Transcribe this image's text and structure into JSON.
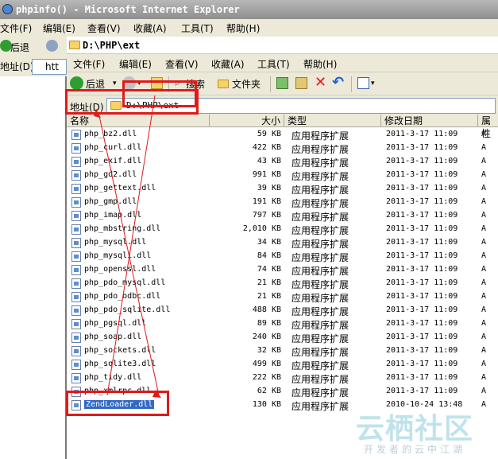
{
  "ie_window": {
    "title": "phpinfo() - Microsoft Internet Explorer",
    "menu": [
      "文件(F)",
      "编辑(E)",
      "查看(V)",
      "收藏(A)",
      "工具(T)",
      "帮助(H)"
    ],
    "back_label": "后退",
    "address_label": "地址(D)",
    "address_value": "htt"
  },
  "explorer": {
    "title": "D:\\PHP\\ext",
    "menu": [
      "文件(F)",
      "编辑(E)",
      "查看(V)",
      "收藏(A)",
      "工具(T)",
      "帮助(H)"
    ],
    "toolbar": {
      "back_label": "后退",
      "search_label": "搜索",
      "folders_label": "文件夹"
    },
    "address_label": "地址(D)",
    "address_value": "D:\\PHP\\ext",
    "columns": [
      "名称",
      "大小",
      "类型",
      "修改日期",
      "属性"
    ],
    "files": [
      {
        "name": "php_bz2.dll",
        "size": "59 KB",
        "type": "应用程序扩展",
        "date": "2011-3-17 11:09",
        "attr": "A"
      },
      {
        "name": "php_curl.dll",
        "size": "422 KB",
        "type": "应用程序扩展",
        "date": "2011-3-17 11:09",
        "attr": "A"
      },
      {
        "name": "php_exif.dll",
        "size": "43 KB",
        "type": "应用程序扩展",
        "date": "2011-3-17 11:09",
        "attr": "A"
      },
      {
        "name": "php_gd2.dll",
        "size": "991 KB",
        "type": "应用程序扩展",
        "date": "2011-3-17 11:09",
        "attr": "A"
      },
      {
        "name": "php_gettext.dll",
        "size": "39 KB",
        "type": "应用程序扩展",
        "date": "2011-3-17 11:09",
        "attr": "A"
      },
      {
        "name": "php_gmp.dll",
        "size": "191 KB",
        "type": "应用程序扩展",
        "date": "2011-3-17 11:09",
        "attr": "A"
      },
      {
        "name": "php_imap.dll",
        "size": "797 KB",
        "type": "应用程序扩展",
        "date": "2011-3-17 11:09",
        "attr": "A"
      },
      {
        "name": "php_mbstring.dll",
        "size": "2,010 KB",
        "type": "应用程序扩展",
        "date": "2011-3-17 11:09",
        "attr": "A"
      },
      {
        "name": "php_mysql.dll",
        "size": "34 KB",
        "type": "应用程序扩展",
        "date": "2011-3-17 11:09",
        "attr": "A"
      },
      {
        "name": "php_mysqli.dll",
        "size": "84 KB",
        "type": "应用程序扩展",
        "date": "2011-3-17 11:09",
        "attr": "A"
      },
      {
        "name": "php_openssl.dll",
        "size": "74 KB",
        "type": "应用程序扩展",
        "date": "2011-3-17 11:09",
        "attr": "A"
      },
      {
        "name": "php_pdo_mysql.dll",
        "size": "21 KB",
        "type": "应用程序扩展",
        "date": "2011-3-17 11:09",
        "attr": "A"
      },
      {
        "name": "php_pdo_odbc.dll",
        "size": "21 KB",
        "type": "应用程序扩展",
        "date": "2011-3-17 11:09",
        "attr": "A"
      },
      {
        "name": "php_pdo_sqlite.dll",
        "size": "488 KB",
        "type": "应用程序扩展",
        "date": "2011-3-17 11:09",
        "attr": "A"
      },
      {
        "name": "php_pgsql.dll",
        "size": "89 KB",
        "type": "应用程序扩展",
        "date": "2011-3-17 11:09",
        "attr": "A"
      },
      {
        "name": "php_soap.dll",
        "size": "240 KB",
        "type": "应用程序扩展",
        "date": "2011-3-17 11:09",
        "attr": "A"
      },
      {
        "name": "php_sockets.dll",
        "size": "32 KB",
        "type": "应用程序扩展",
        "date": "2011-3-17 11:09",
        "attr": "A"
      },
      {
        "name": "php_sqlite3.dll",
        "size": "499 KB",
        "type": "应用程序扩展",
        "date": "2011-3-17 11:09",
        "attr": "A"
      },
      {
        "name": "php_tidy.dll",
        "size": "222 KB",
        "type": "应用程序扩展",
        "date": "2011-3-17 11:09",
        "attr": "A"
      },
      {
        "name": "php_xmlrpc.dll",
        "size": "62 KB",
        "type": "应用程序扩展",
        "date": "2011-3-17 11:09",
        "attr": "A"
      },
      {
        "name": "ZendLoader.dll",
        "size": "130 KB",
        "type": "应用程序扩展",
        "date": "2010-10-24 13:48",
        "attr": "A"
      }
    ]
  },
  "watermark": {
    "main": "云栖社区",
    "sub": "开发者的云中江湖"
  },
  "colors": {
    "annotation_red": "#e0191b",
    "selection_blue": "#316ac5"
  }
}
